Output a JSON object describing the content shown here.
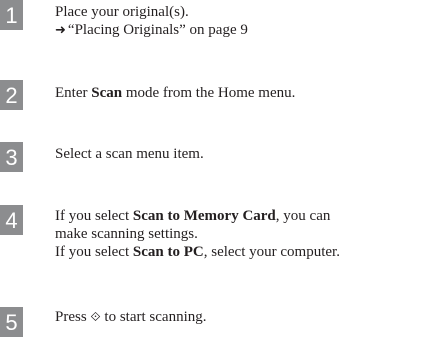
{
  "steps": [
    {
      "number": "1",
      "line1": "Place your original(s).",
      "link_arrow": "➜",
      "link_text": "“Placing Originals” on page 9"
    },
    {
      "number": "2",
      "pre": "Enter ",
      "bold": "Scan",
      "post": " mode from the Home menu."
    },
    {
      "number": "3",
      "text": "Select a scan menu item."
    },
    {
      "number": "4",
      "l1_pre": "If you select ",
      "l1_bold": "Scan to Memory Card",
      "l1_post": ", you can",
      "l2": "make scanning settings.",
      "l3_pre": "If you select ",
      "l3_bold": "Scan to PC",
      "l3_post": ", select your computer."
    },
    {
      "number": "5",
      "pre": "Press ",
      "icon": "⟐",
      "post": " to start scanning."
    }
  ]
}
